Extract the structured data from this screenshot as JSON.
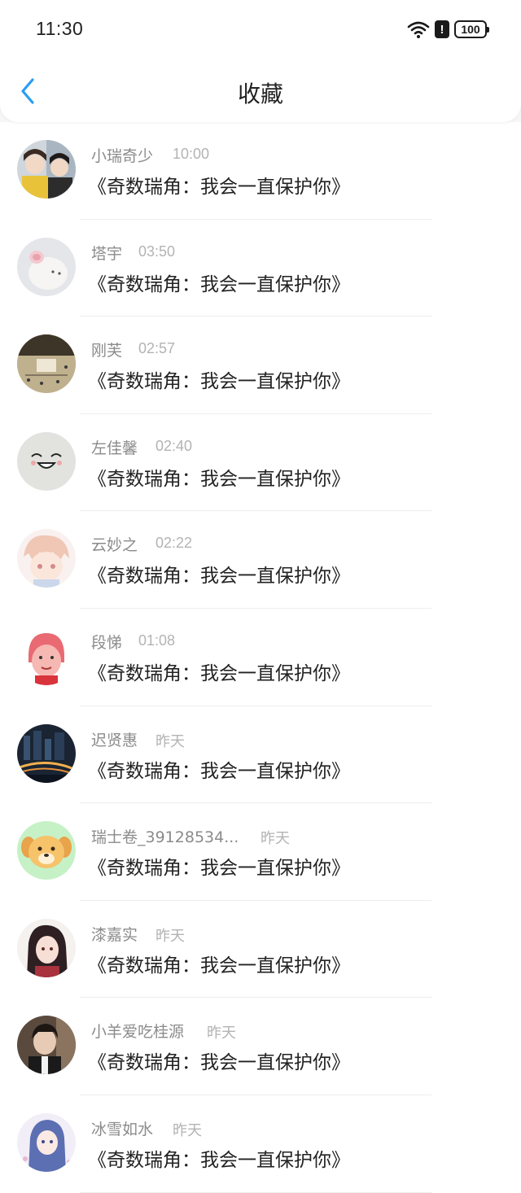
{
  "status_bar": {
    "time": "11:30",
    "battery": "100",
    "alert": "!",
    "icons": [
      "wifi-icon",
      "alert-icon",
      "battery-icon"
    ]
  },
  "nav": {
    "back_icon": "chevron-left-icon",
    "title": "收藏"
  },
  "colors": {
    "accent": "#2a9df4",
    "name_text": "#8b8b8b",
    "time_text": "#b3b3b3",
    "title_text": "#222222",
    "background": "#f7f7f7"
  },
  "items": [
    {
      "name": "小瑞奇少",
      "time": "10:00",
      "title": "《奇数瑞角：我会一直保护你》",
      "avatar": "two-boys-photo"
    },
    {
      "name": "塔宇",
      "time": "03:50",
      "title": "《奇数瑞角：我会一直保护你》",
      "avatar": "plush-pig-photo"
    },
    {
      "name": "刚芙",
      "time": "02:57",
      "title": "《奇数瑞角：我会一直保护你》",
      "avatar": "crossroad-photo"
    },
    {
      "name": "左佳馨",
      "time": "02:40",
      "title": "《奇数瑞角：我会一直保护你》",
      "avatar": "smile-face-drawing"
    },
    {
      "name": "云妙之",
      "time": "02:22",
      "title": "《奇数瑞角：我会一直保护你》",
      "avatar": "anime-boy-drawing"
    },
    {
      "name": "段悌",
      "time": "01:08",
      "title": "《奇数瑞角：我会一直保护你》",
      "avatar": "cartoon-grandma-drawing"
    },
    {
      "name": "迟贤惠",
      "time": "昨天",
      "title": "《奇数瑞角：我会一直保护你》",
      "avatar": "city-night-photo"
    },
    {
      "name": "瑞士卷_39128534...",
      "time": "昨天",
      "title": "《奇数瑞角：我会一直保护你》",
      "avatar": "cartoon-dog-drawing"
    },
    {
      "name": "漆嘉实",
      "time": "昨天",
      "title": "《奇数瑞角：我会一直保护你》",
      "avatar": "anime-girl-drawing"
    },
    {
      "name": "小羊爱吃桂源",
      "time": "昨天",
      "title": "《奇数瑞角：我会一直保护你》",
      "avatar": "boy-portrait-photo"
    },
    {
      "name": "冰雪如水",
      "time": "昨天",
      "title": "《奇数瑞角：我会一直保护你》",
      "avatar": "anime-princess-drawing"
    }
  ]
}
